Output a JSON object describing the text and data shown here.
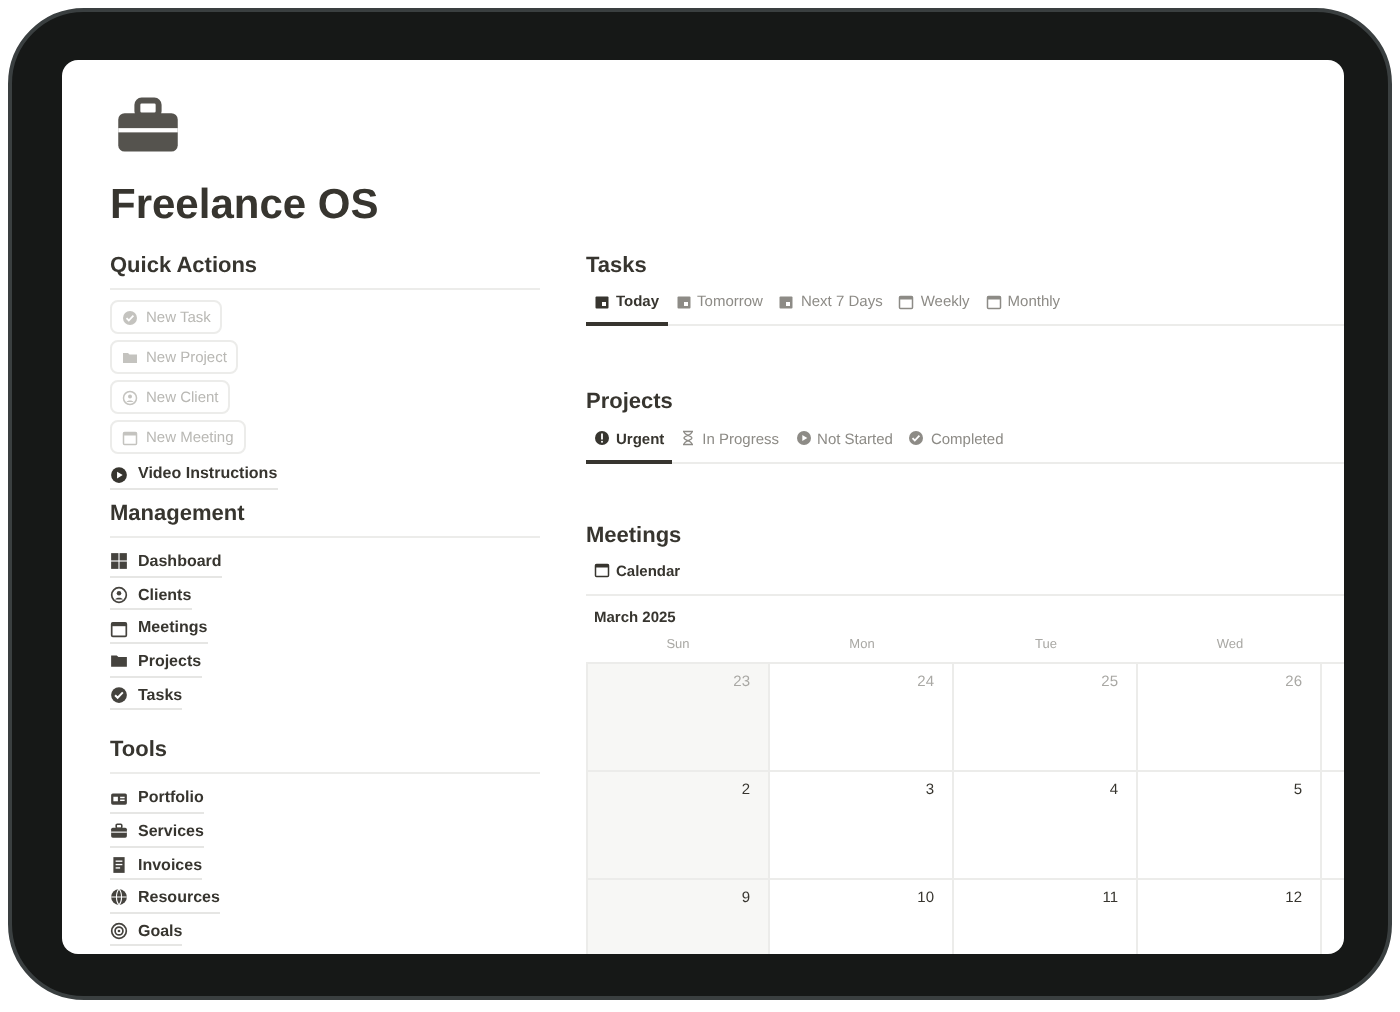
{
  "page": {
    "title": "Freelance OS"
  },
  "quick_actions": {
    "heading": "Quick Actions",
    "buttons": [
      {
        "label": "New Task",
        "disabled": true
      },
      {
        "label": "New Project",
        "disabled": true
      },
      {
        "label": "New Client",
        "disabled": true
      },
      {
        "label": "New Meeting",
        "disabled": true
      }
    ],
    "link": "Video Instructions"
  },
  "management": {
    "heading": "Management",
    "items": [
      "Dashboard",
      "Clients",
      "Meetings",
      "Projects",
      "Tasks"
    ]
  },
  "tools": {
    "heading": "Tools",
    "items": [
      "Portfolio",
      "Services",
      "Invoices",
      "Resources",
      "Goals"
    ]
  },
  "tasks": {
    "heading": "Tasks",
    "tabs": [
      {
        "label": "Today",
        "selected": true
      },
      {
        "label": "Tomorrow",
        "selected": false
      },
      {
        "label": "Next 7 Days",
        "selected": false
      },
      {
        "label": "Weekly",
        "selected": false
      },
      {
        "label": "Monthly",
        "selected": false
      }
    ]
  },
  "projects": {
    "heading": "Projects",
    "tabs": [
      {
        "label": "Urgent",
        "selected": true
      },
      {
        "label": "In Progress",
        "selected": false
      },
      {
        "label": "Not Started",
        "selected": false
      },
      {
        "label": "Completed",
        "selected": false
      }
    ]
  },
  "meetings": {
    "heading": "Meetings",
    "view_tab": "Calendar",
    "calendar": {
      "month": "March 2025",
      "weekdays": [
        "Sun",
        "Mon",
        "Tue",
        "Wed"
      ],
      "weeks": [
        {
          "days": [
            {
              "day": "23",
              "in_month": false
            },
            {
              "day": "24",
              "in_month": false
            },
            {
              "day": "25",
              "in_month": false
            },
            {
              "day": "26",
              "in_month": false
            }
          ]
        },
        {
          "days": [
            {
              "day": "2",
              "in_month": true
            },
            {
              "day": "3",
              "in_month": true
            },
            {
              "day": "4",
              "in_month": true
            },
            {
              "day": "5",
              "in_month": true
            }
          ]
        },
        {
          "days": [
            {
              "day": "9",
              "in_month": true
            },
            {
              "day": "10",
              "in_month": true
            },
            {
              "day": "11",
              "in_month": true
            },
            {
              "day": "12",
              "in_month": true
            }
          ]
        }
      ]
    }
  }
}
